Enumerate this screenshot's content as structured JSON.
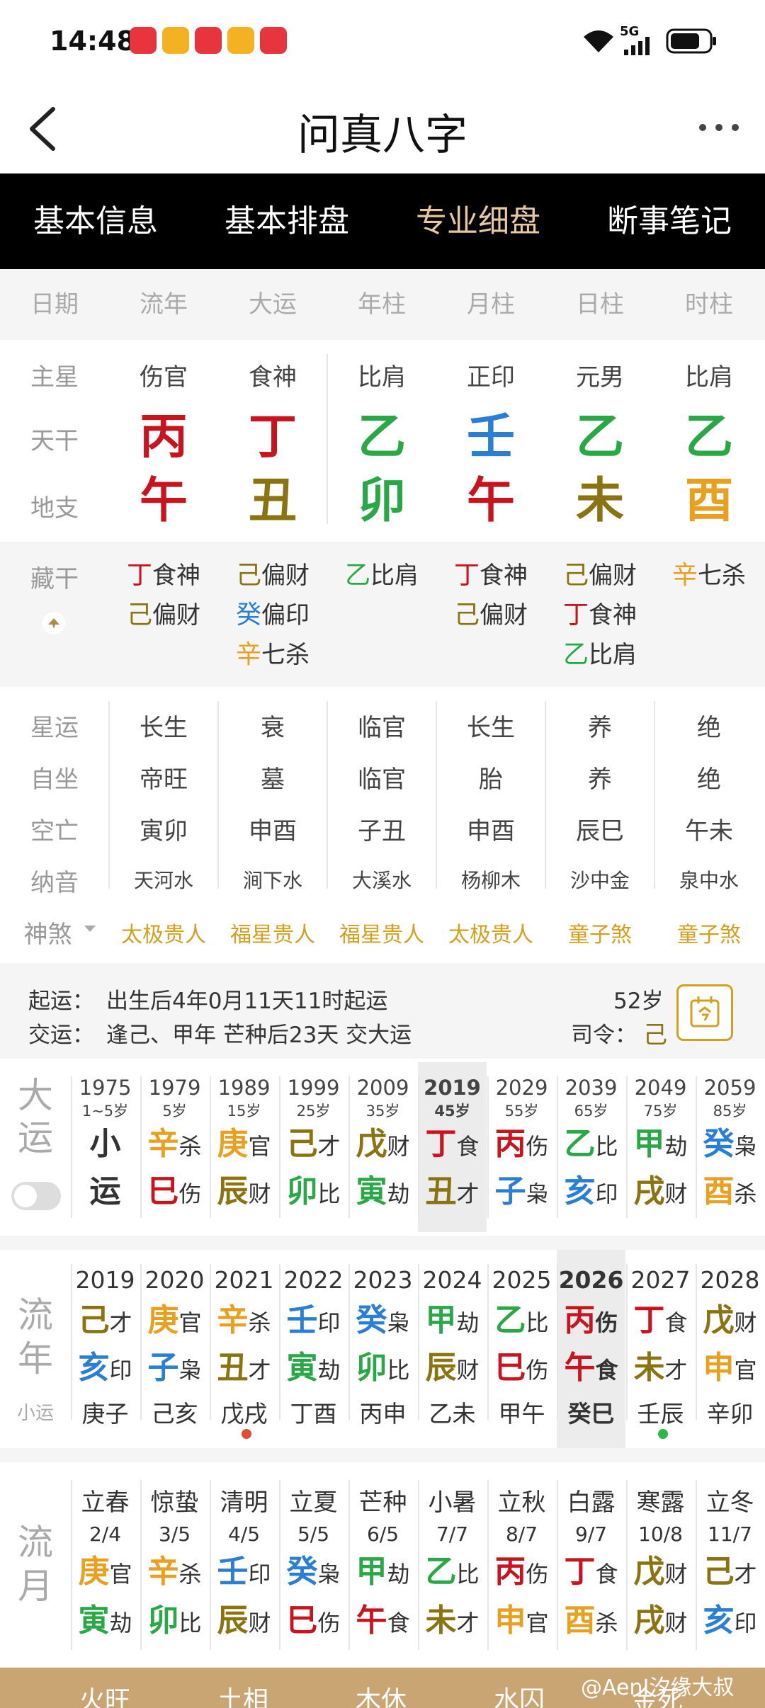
{
  "status": {
    "time": "14:48",
    "signal": "5G"
  },
  "header": {
    "title": "问真八字"
  },
  "tabs": [
    "基本信息",
    "基本排盘",
    "专业细盘",
    "断事笔记"
  ],
  "active_tab": 2,
  "columns": [
    "日期",
    "流年",
    "大运",
    "年柱",
    "月柱",
    "日柱",
    "时柱"
  ],
  "labels": {
    "main_star": "主星",
    "tiangan": "天干",
    "dizhi": "地支",
    "canggan": "藏干",
    "xingyun": "星运",
    "zizuo": "自坐",
    "kongwang": "空亡",
    "nayin": "纳音",
    "shensha": "神煞"
  },
  "main_star": [
    "伤官",
    "食神",
    "比肩",
    "正印",
    "元男",
    "比肩"
  ],
  "tiangan": [
    {
      "c": "丙",
      "color": "#c8141e"
    },
    {
      "c": "丁",
      "color": "#c8141e"
    },
    {
      "c": "乙",
      "color": "#2aa848"
    },
    {
      "c": "壬",
      "color": "#2a7fd4"
    },
    {
      "c": "乙",
      "color": "#2aa848"
    },
    {
      "c": "乙",
      "color": "#2aa848"
    }
  ],
  "dizhi": [
    {
      "c": "午",
      "color": "#c8141e"
    },
    {
      "c": "丑",
      "color": "#8a7412"
    },
    {
      "c": "卯",
      "color": "#2aa848"
    },
    {
      "c": "午",
      "color": "#c8141e"
    },
    {
      "c": "未",
      "color": "#8a7412"
    },
    {
      "c": "酉",
      "color": "#e8a020"
    }
  ],
  "canggan": [
    [
      {
        "g": "丁",
        "t": "食神",
        "color": "#c8141e"
      },
      {
        "g": "己",
        "t": "偏财",
        "color": "#8a7412"
      }
    ],
    [
      {
        "g": "己",
        "t": "偏财",
        "color": "#8a7412"
      },
      {
        "g": "癸",
        "t": "偏印",
        "color": "#2a7fd4"
      },
      {
        "g": "辛",
        "t": "七杀",
        "color": "#e8a020"
      }
    ],
    [
      {
        "g": "乙",
        "t": "比肩",
        "color": "#2aa848"
      }
    ],
    [
      {
        "g": "丁",
        "t": "食神",
        "color": "#c8141e"
      },
      {
        "g": "己",
        "t": "偏财",
        "color": "#8a7412"
      }
    ],
    [
      {
        "g": "己",
        "t": "偏财",
        "color": "#8a7412"
      },
      {
        "g": "丁",
        "t": "食神",
        "color": "#c8141e"
      },
      {
        "g": "乙",
        "t": "比肩",
        "color": "#2aa848"
      }
    ],
    [
      {
        "g": "辛",
        "t": "七杀",
        "color": "#e8a020"
      }
    ]
  ],
  "xingyun": [
    "长生",
    "衰",
    "临官",
    "长生",
    "养",
    "绝"
  ],
  "zizuo": [
    "帝旺",
    "墓",
    "临官",
    "胎",
    "养",
    "绝"
  ],
  "kongwang": [
    "寅卯",
    "申酉",
    "子丑",
    "申酉",
    "辰巳",
    "午未"
  ],
  "nayin": [
    "天河水",
    "涧下水",
    "大溪水",
    "杨柳木",
    "沙中金",
    "泉中水"
  ],
  "shensha": [
    "太极贵人",
    "福星贵人",
    "福星贵人",
    "太极贵人",
    "童子煞",
    "童子煞"
  ],
  "qiyun": {
    "l1": "起运：",
    "v1": "出生后4年0月11天11时起运",
    "l2": "交运：",
    "v2": "逢己、甲年 芒种后23天 交大运",
    "age": "52岁",
    "siling_l": "司令：",
    "siling": "己"
  },
  "dayun_label": [
    "大",
    "运"
  ],
  "dayun": [
    {
      "yr": "1975",
      "ag": "1~5岁",
      "g": "小",
      "gt": "",
      "gc": "#333",
      "z": "运",
      "zt": "",
      "zc": "#333"
    },
    {
      "yr": "1979",
      "ag": "5岁",
      "g": "辛",
      "gt": "杀",
      "gc": "#e8a020",
      "z": "巳",
      "zt": "伤",
      "zc": "#c8141e"
    },
    {
      "yr": "1989",
      "ag": "15岁",
      "g": "庚",
      "gt": "官",
      "gc": "#e8a020",
      "z": "辰",
      "zt": "财",
      "zc": "#8a7412"
    },
    {
      "yr": "1999",
      "ag": "25岁",
      "g": "己",
      "gt": "才",
      "gc": "#8a7412",
      "z": "卯",
      "zt": "比",
      "zc": "#2aa848"
    },
    {
      "yr": "2009",
      "ag": "35岁",
      "g": "戊",
      "gt": "财",
      "gc": "#8a7412",
      "z": "寅",
      "zt": "劫",
      "zc": "#2aa848"
    },
    {
      "yr": "2019",
      "ag": "45岁",
      "g": "丁",
      "gt": "食",
      "gc": "#c8141e",
      "z": "丑",
      "zt": "才",
      "zc": "#8a7412"
    },
    {
      "yr": "2029",
      "ag": "55岁",
      "g": "丙",
      "gt": "伤",
      "gc": "#c8141e",
      "z": "子",
      "zt": "枭",
      "zc": "#2a7fd4"
    },
    {
      "yr": "2039",
      "ag": "65岁",
      "g": "乙",
      "gt": "比",
      "gc": "#2aa848",
      "z": "亥",
      "zt": "印",
      "zc": "#2a7fd4"
    },
    {
      "yr": "2049",
      "ag": "75岁",
      "g": "甲",
      "gt": "劫",
      "gc": "#2aa848",
      "z": "戌",
      "zt": "财",
      "zc": "#8a7412"
    },
    {
      "yr": "2059",
      "ag": "85岁",
      "g": "癸",
      "gt": "枭",
      "gc": "#2a7fd4",
      "z": "酉",
      "zt": "杀",
      "zc": "#e8a020"
    }
  ],
  "liunian_label": [
    "流",
    "年"
  ],
  "xiaoyun_label": "小运",
  "liunian": [
    {
      "yr": "2019",
      "g": "己",
      "gt": "才",
      "gc": "#8a7412",
      "z": "亥",
      "zt": "印",
      "zc": "#2a7fd4",
      "x": "庚子"
    },
    {
      "yr": "2020",
      "g": "庚",
      "gt": "官",
      "gc": "#e8a020",
      "z": "子",
      "zt": "枭",
      "zc": "#2a7fd4",
      "x": "己亥"
    },
    {
      "yr": "2021",
      "g": "辛",
      "gt": "杀",
      "gc": "#e8a020",
      "z": "丑",
      "zt": "才",
      "zc": "#8a7412",
      "x": "戊戌"
    },
    {
      "yr": "2022",
      "g": "壬",
      "gt": "印",
      "gc": "#2a7fd4",
      "z": "寅",
      "zt": "劫",
      "zc": "#2aa848",
      "x": "丁酉"
    },
    {
      "yr": "2023",
      "g": "癸",
      "gt": "枭",
      "gc": "#2a7fd4",
      "z": "卯",
      "zt": "比",
      "zc": "#2aa848",
      "x": "丙申"
    },
    {
      "yr": "2024",
      "g": "甲",
      "gt": "劫",
      "gc": "#2aa848",
      "z": "辰",
      "zt": "财",
      "zc": "#8a7412",
      "x": "乙未"
    },
    {
      "yr": "2025",
      "g": "乙",
      "gt": "比",
      "gc": "#2aa848",
      "z": "巳",
      "zt": "伤",
      "zc": "#c8141e",
      "x": "甲午"
    },
    {
      "yr": "2026",
      "g": "丙",
      "gt": "伤",
      "gc": "#c8141e",
      "z": "午",
      "zt": "食",
      "zc": "#c8141e",
      "x": "癸巳"
    },
    {
      "yr": "2027",
      "g": "丁",
      "gt": "食",
      "gc": "#c8141e",
      "z": "未",
      "zt": "才",
      "zc": "#8a7412",
      "x": "壬辰"
    },
    {
      "yr": "2028",
      "g": "戊",
      "gt": "财",
      "gc": "#8a7412",
      "z": "申",
      "zt": "官",
      "zc": "#e8a020",
      "x": "辛卯"
    }
  ],
  "liuyue_label": [
    "流",
    "月"
  ],
  "liuyue": [
    {
      "jq": "立春",
      "dt": "2/4",
      "g": "庚",
      "gt": "官",
      "gc": "#e8a020",
      "z": "寅",
      "zt": "劫",
      "zc": "#2aa848"
    },
    {
      "jq": "惊蛰",
      "dt": "3/5",
      "g": "辛",
      "gt": "杀",
      "gc": "#e8a020",
      "z": "卯",
      "zt": "比",
      "zc": "#2aa848"
    },
    {
      "jq": "清明",
      "dt": "4/5",
      "g": "壬",
      "gt": "印",
      "gc": "#2a7fd4",
      "z": "辰",
      "zt": "财",
      "zc": "#8a7412"
    },
    {
      "jq": "立夏",
      "dt": "5/5",
      "g": "癸",
      "gt": "枭",
      "gc": "#2a7fd4",
      "z": "巳",
      "zt": "伤",
      "zc": "#c8141e"
    },
    {
      "jq": "芒种",
      "dt": "6/5",
      "g": "甲",
      "gt": "劫",
      "gc": "#2aa848",
      "z": "午",
      "zt": "食",
      "zc": "#c8141e"
    },
    {
      "jq": "小暑",
      "dt": "7/7",
      "g": "乙",
      "gt": "比",
      "gc": "#2aa848",
      "z": "未",
      "zt": "才",
      "zc": "#8a7412"
    },
    {
      "jq": "立秋",
      "dt": "8/7",
      "g": "丙",
      "gt": "伤",
      "gc": "#c8141e",
      "z": "申",
      "zt": "官",
      "zc": "#e8a020"
    },
    {
      "jq": "白露",
      "dt": "9/7",
      "g": "丁",
      "gt": "食",
      "gc": "#c8141e",
      "z": "酉",
      "zt": "杀",
      "zc": "#e8a020"
    },
    {
      "jq": "寒露",
      "dt": "10/8",
      "g": "戊",
      "gt": "财",
      "gc": "#8a7412",
      "z": "戌",
      "zt": "财",
      "zc": "#8a7412"
    },
    {
      "jq": "立冬",
      "dt": "11/7",
      "g": "己",
      "gt": "才",
      "gc": "#8a7412",
      "z": "亥",
      "zt": "印",
      "zc": "#2a7fd4"
    }
  ],
  "bottom": [
    "火旺",
    "土相",
    "木休",
    "水囚",
    "金死"
  ],
  "watermark": "@AenI汐缘大叔"
}
